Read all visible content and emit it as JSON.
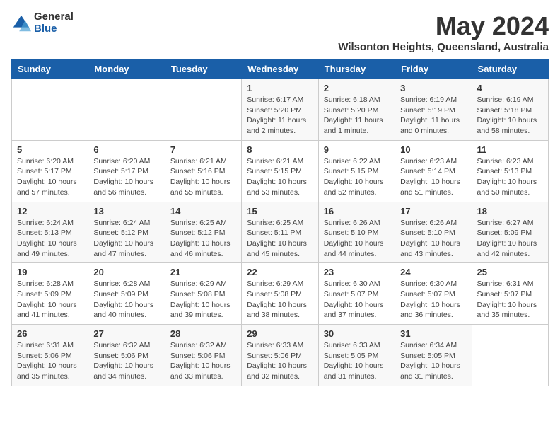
{
  "logo": {
    "general": "General",
    "blue": "Blue"
  },
  "title": "May 2024",
  "subtitle": "Wilsonton Heights, Queensland, Australia",
  "weekdays": [
    "Sunday",
    "Monday",
    "Tuesday",
    "Wednesday",
    "Thursday",
    "Friday",
    "Saturday"
  ],
  "weeks": [
    [
      {
        "day": "",
        "detail": ""
      },
      {
        "day": "",
        "detail": ""
      },
      {
        "day": "",
        "detail": ""
      },
      {
        "day": "1",
        "detail": "Sunrise: 6:17 AM\nSunset: 5:20 PM\nDaylight: 11 hours\nand 2 minutes."
      },
      {
        "day": "2",
        "detail": "Sunrise: 6:18 AM\nSunset: 5:20 PM\nDaylight: 11 hours\nand 1 minute."
      },
      {
        "day": "3",
        "detail": "Sunrise: 6:19 AM\nSunset: 5:19 PM\nDaylight: 11 hours\nand 0 minutes."
      },
      {
        "day": "4",
        "detail": "Sunrise: 6:19 AM\nSunset: 5:18 PM\nDaylight: 10 hours\nand 58 minutes."
      }
    ],
    [
      {
        "day": "5",
        "detail": "Sunrise: 6:20 AM\nSunset: 5:17 PM\nDaylight: 10 hours\nand 57 minutes."
      },
      {
        "day": "6",
        "detail": "Sunrise: 6:20 AM\nSunset: 5:17 PM\nDaylight: 10 hours\nand 56 minutes."
      },
      {
        "day": "7",
        "detail": "Sunrise: 6:21 AM\nSunset: 5:16 PM\nDaylight: 10 hours\nand 55 minutes."
      },
      {
        "day": "8",
        "detail": "Sunrise: 6:21 AM\nSunset: 5:15 PM\nDaylight: 10 hours\nand 53 minutes."
      },
      {
        "day": "9",
        "detail": "Sunrise: 6:22 AM\nSunset: 5:15 PM\nDaylight: 10 hours\nand 52 minutes."
      },
      {
        "day": "10",
        "detail": "Sunrise: 6:23 AM\nSunset: 5:14 PM\nDaylight: 10 hours\nand 51 minutes."
      },
      {
        "day": "11",
        "detail": "Sunrise: 6:23 AM\nSunset: 5:13 PM\nDaylight: 10 hours\nand 50 minutes."
      }
    ],
    [
      {
        "day": "12",
        "detail": "Sunrise: 6:24 AM\nSunset: 5:13 PM\nDaylight: 10 hours\nand 49 minutes."
      },
      {
        "day": "13",
        "detail": "Sunrise: 6:24 AM\nSunset: 5:12 PM\nDaylight: 10 hours\nand 47 minutes."
      },
      {
        "day": "14",
        "detail": "Sunrise: 6:25 AM\nSunset: 5:12 PM\nDaylight: 10 hours\nand 46 minutes."
      },
      {
        "day": "15",
        "detail": "Sunrise: 6:25 AM\nSunset: 5:11 PM\nDaylight: 10 hours\nand 45 minutes."
      },
      {
        "day": "16",
        "detail": "Sunrise: 6:26 AM\nSunset: 5:10 PM\nDaylight: 10 hours\nand 44 minutes."
      },
      {
        "day": "17",
        "detail": "Sunrise: 6:26 AM\nSunset: 5:10 PM\nDaylight: 10 hours\nand 43 minutes."
      },
      {
        "day": "18",
        "detail": "Sunrise: 6:27 AM\nSunset: 5:09 PM\nDaylight: 10 hours\nand 42 minutes."
      }
    ],
    [
      {
        "day": "19",
        "detail": "Sunrise: 6:28 AM\nSunset: 5:09 PM\nDaylight: 10 hours\nand 41 minutes."
      },
      {
        "day": "20",
        "detail": "Sunrise: 6:28 AM\nSunset: 5:09 PM\nDaylight: 10 hours\nand 40 minutes."
      },
      {
        "day": "21",
        "detail": "Sunrise: 6:29 AM\nSunset: 5:08 PM\nDaylight: 10 hours\nand 39 minutes."
      },
      {
        "day": "22",
        "detail": "Sunrise: 6:29 AM\nSunset: 5:08 PM\nDaylight: 10 hours\nand 38 minutes."
      },
      {
        "day": "23",
        "detail": "Sunrise: 6:30 AM\nSunset: 5:07 PM\nDaylight: 10 hours\nand 37 minutes."
      },
      {
        "day": "24",
        "detail": "Sunrise: 6:30 AM\nSunset: 5:07 PM\nDaylight: 10 hours\nand 36 minutes."
      },
      {
        "day": "25",
        "detail": "Sunrise: 6:31 AM\nSunset: 5:07 PM\nDaylight: 10 hours\nand 35 minutes."
      }
    ],
    [
      {
        "day": "26",
        "detail": "Sunrise: 6:31 AM\nSunset: 5:06 PM\nDaylight: 10 hours\nand 35 minutes."
      },
      {
        "day": "27",
        "detail": "Sunrise: 6:32 AM\nSunset: 5:06 PM\nDaylight: 10 hours\nand 34 minutes."
      },
      {
        "day": "28",
        "detail": "Sunrise: 6:32 AM\nSunset: 5:06 PM\nDaylight: 10 hours\nand 33 minutes."
      },
      {
        "day": "29",
        "detail": "Sunrise: 6:33 AM\nSunset: 5:06 PM\nDaylight: 10 hours\nand 32 minutes."
      },
      {
        "day": "30",
        "detail": "Sunrise: 6:33 AM\nSunset: 5:05 PM\nDaylight: 10 hours\nand 31 minutes."
      },
      {
        "day": "31",
        "detail": "Sunrise: 6:34 AM\nSunset: 5:05 PM\nDaylight: 10 hours\nand 31 minutes."
      },
      {
        "day": "",
        "detail": ""
      }
    ]
  ]
}
